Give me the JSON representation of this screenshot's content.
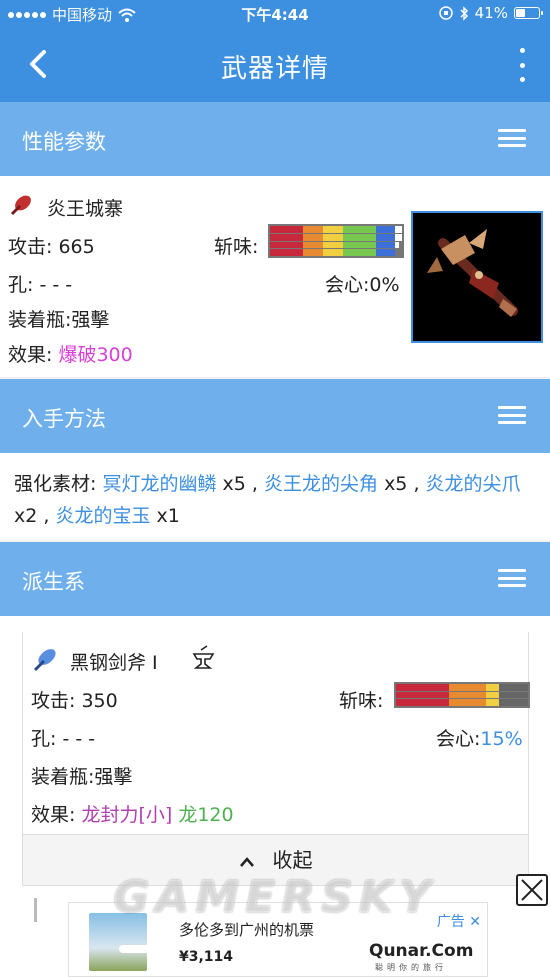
{
  "status": {
    "carrier": "中国移动",
    "time": "下午4:44",
    "battery": "41%"
  },
  "nav": {
    "title": "武器详情",
    "back_icon": "chevron-left-icon",
    "more_icon": "more-vertical-icon"
  },
  "sections": {
    "performance": "性能参数",
    "acquire": "入手方法",
    "derivation": "派生系"
  },
  "weapon": {
    "name": "炎王城寨",
    "attack_label": "攻击:",
    "attack": "665",
    "sharpness_label": "斩味:",
    "slots_label": "孔:",
    "slots": "- - -",
    "affinity_label": "会心:",
    "affinity": "0%",
    "phial_label": "装着瓶:",
    "phial": "强擊",
    "effect_label": "效果:",
    "effect": "爆破300",
    "effect_color": "#d840d8",
    "sharpness": {
      "colors": [
        "#c8283c",
        "#e88a30",
        "#f0d040",
        "#78c850",
        "#3c70d8",
        "#ffffff"
      ],
      "rows": [
        [
          0.25,
          0.15,
          0.15,
          0.25,
          0.15,
          0.05
        ],
        [
          0.25,
          0.15,
          0.15,
          0.25,
          0.15,
          0.05
        ],
        [
          0.25,
          0.15,
          0.15,
          0.25,
          0.15,
          0.03
        ],
        [
          0.25,
          0.15,
          0.15,
          0.25,
          0.15,
          0.0
        ]
      ]
    }
  },
  "acquire": {
    "prefix": "强化素材:",
    "items": [
      {
        "name": "冥灯龙的幽鳞",
        "qty": "x5"
      },
      {
        "name": "炎王龙的尖角",
        "qty": "x5"
      },
      {
        "name": "炎龙的尖爪",
        "qty": "x2"
      },
      {
        "name": "炎龙的宝玉",
        "qty": "x1"
      }
    ],
    "separator": ","
  },
  "derived": {
    "name": "黑钢剑斧 I",
    "forge_icon": "anvil-icon",
    "attack_label": "攻击:",
    "attack": "350",
    "sharpness_label": "斩味:",
    "slots_label": "孔:",
    "slots": "- - -",
    "affinity_label": "会心:",
    "affinity": "15%",
    "phial_label": "装着瓶:",
    "phial": "强擊",
    "effect_label": "效果:",
    "effect_1": "龙封力[小]",
    "effect_2": "龙120",
    "sharpness": {
      "colors": [
        "#c8283c",
        "#e88a30",
        "#f0d040",
        "#666666"
      ],
      "rows": [
        [
          0.4,
          0.28,
          0.1,
          0.22
        ],
        [
          0.4,
          0.28,
          0.1,
          0.22
        ],
        [
          0.4,
          0.28,
          0.1,
          0.22
        ]
      ]
    },
    "collapse_label": "收起"
  },
  "ad": {
    "headline": "多伦多到广州的机票",
    "price": "¥3,114",
    "brand": "Qunar.Com",
    "brand_sub": "聪明你的旅行",
    "tag": "广告"
  },
  "watermark": "GAMERSKY"
}
